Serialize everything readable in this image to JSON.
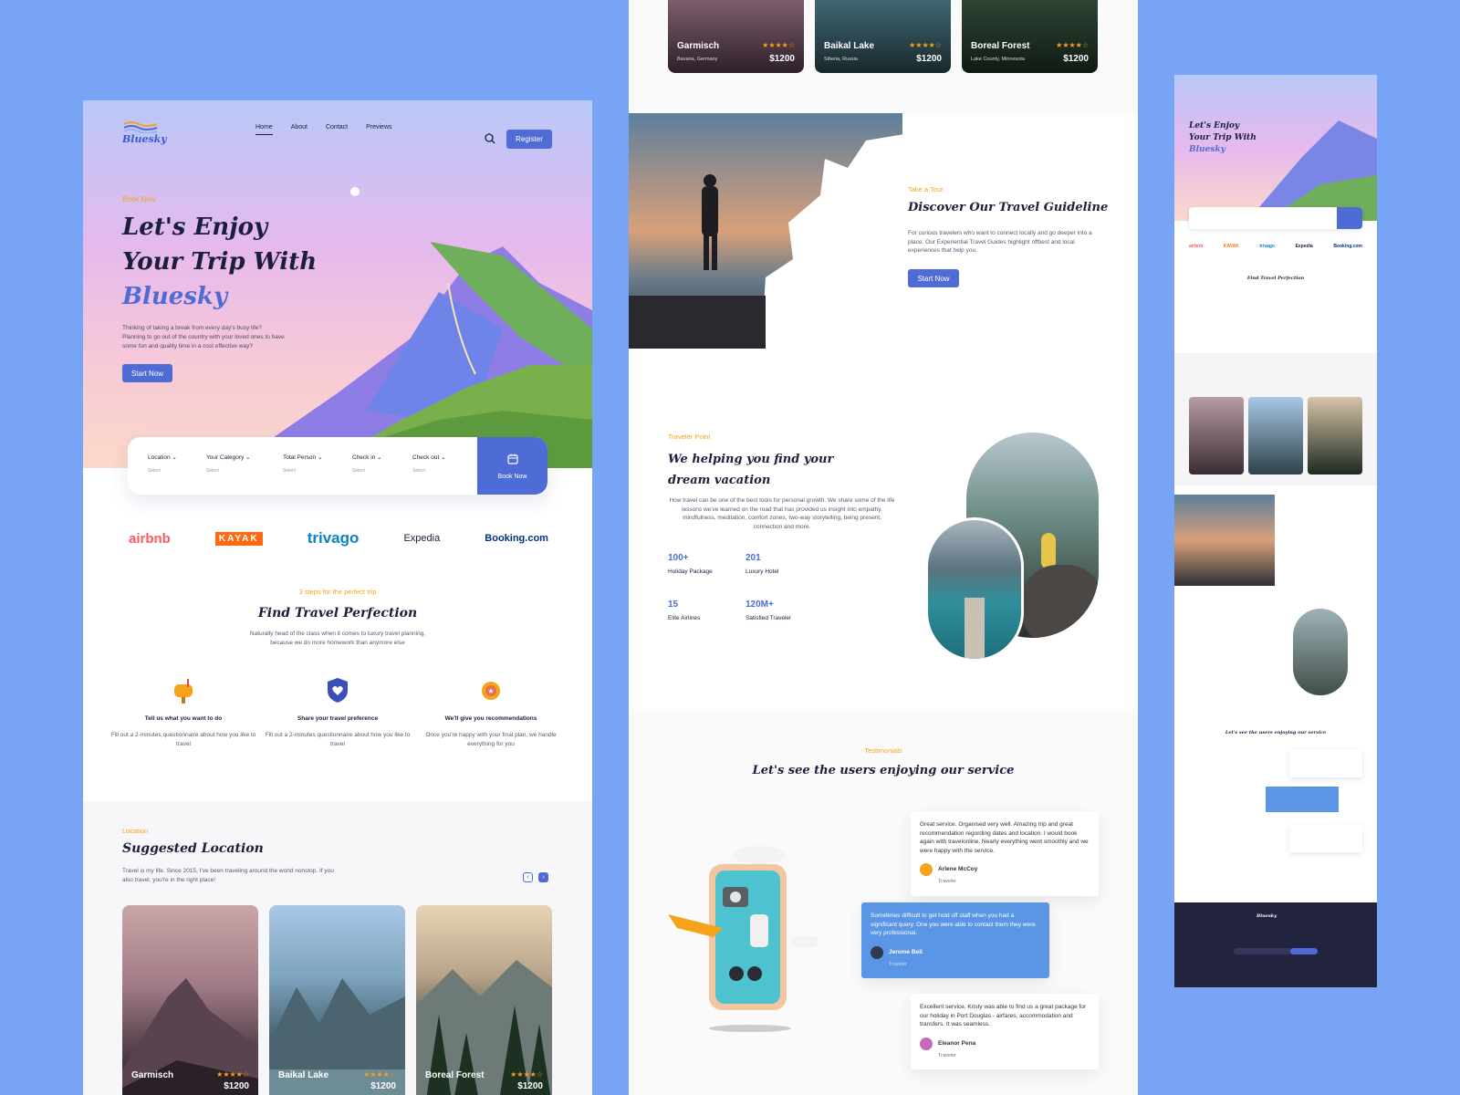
{
  "brand": {
    "name": "Bluesky",
    "accent": "#4F6BD6",
    "highlight": "#F5A31A"
  },
  "nav": {
    "links": [
      "Home",
      "About",
      "Contact",
      "Previews"
    ],
    "register": "Register"
  },
  "hero": {
    "eyebrow": "Book Now",
    "title_line1": "Let's Enjoy",
    "title_line2": "Your Trip With",
    "title_line3": "Bluesky",
    "desc": "Thinking of taking a break from every day's busy life? Planning to go out of the country with your loved ones to have some fun and quality time in a cost effective way?",
    "cta": "Start Now"
  },
  "searchbar": {
    "fields": [
      {
        "label": "Location",
        "value": "Select"
      },
      {
        "label": "Your Category",
        "value": "Select"
      },
      {
        "label": "Total Person",
        "value": "Select"
      },
      {
        "label": "Check in",
        "value": "Select"
      },
      {
        "label": "Check out",
        "value": "Select"
      }
    ],
    "book": "Book Now"
  },
  "partners": [
    "airbnb",
    "KAYAK",
    "trivago",
    "Expedia",
    "Booking.com"
  ],
  "steps": {
    "eyebrow": "3 steps for the perfect trip",
    "title": "Find Travel Perfection",
    "desc_line1": "Naturally head of the class when it comes to luxury travel planning,",
    "desc_line2": "because we do more homework than anymore else",
    "items": [
      {
        "title": "Tell us what you want to do",
        "desc": "Fill out a 2-minutes questionnaire about how you like to travel",
        "icon": "mailbox-icon"
      },
      {
        "title": "Share your travel preference",
        "desc": "Fill out a 2-minutes questionnaire about how you like to travel",
        "icon": "shield-heart-icon"
      },
      {
        "title": "We'll give you recommendations",
        "desc": "Once you're happy with your final plan, we handle everything for you",
        "icon": "award-badge-icon"
      }
    ]
  },
  "location": {
    "eyebrow": "Location",
    "title": "Suggested Location",
    "desc": "Travel is my life. Since 2015, I've been traveling around the world nonstop. If you also travel, you're in the right place!",
    "cards": [
      {
        "name": "Garmisch",
        "place": "Bavaria, Germany",
        "price": "$1200",
        "rating": "★★★★☆"
      },
      {
        "name": "Baikal Lake",
        "place": "Siberia, Russia",
        "price": "$1200",
        "rating": "★★★★☆"
      },
      {
        "name": "Boreal Forest",
        "place": "Lake County, Minnesota",
        "price": "$1200",
        "rating": "★★★★☆"
      }
    ]
  },
  "guide": {
    "eyebrow": "Take a Tour",
    "title": "Discover Our Travel Guideline",
    "desc": "For curious travelers who want to connect locally and go deeper into a place. Our Experiential Travel Guides highlight offbest and local experiences that help you.",
    "cta": "Start Now"
  },
  "traveler": {
    "eyebrow": "Traveler Point",
    "title": "We helping you find your dream vacation",
    "desc": "How travel can be one of the best tools for personal growth. We share some of the life lessons we've learned on the road that has provided us insight into empathy, mindfulness, meditation, comfort zones, two-way storytelling, being present, connection and more.",
    "stats": [
      {
        "value": "100+",
        "label": "Holiday Package"
      },
      {
        "value": "201",
        "label": "Luxury Hotel"
      },
      {
        "value": "15",
        "label": "Elite Airlines"
      },
      {
        "value": "120M+",
        "label": "Satisfied Traveler"
      }
    ]
  },
  "testimonials": {
    "eyebrow": "Testimonials",
    "title": "Let's see the users enjoying our service",
    "items": [
      {
        "text": "Great service. Organised very well. Amazing trip and great recommendation regording dates and location. I would book again with travelonline. Nearly everything went smoothly and we were happy with the service.",
        "name": "Arlene McCoy",
        "role": "Traveler"
      },
      {
        "text": "Sometimes difficult to get hold off staff when you had a significant query. One you were able to contact them they were very professional.",
        "name": "Jerome Bell",
        "role": "Traveler"
      },
      {
        "text": "Excellent service. Kristy was able to find us a great package for our holiday in Port Douglas - airfares, accommodation and transfers. It was seamless.",
        "name": "Eleanor Pena",
        "role": "Traveler"
      }
    ]
  }
}
